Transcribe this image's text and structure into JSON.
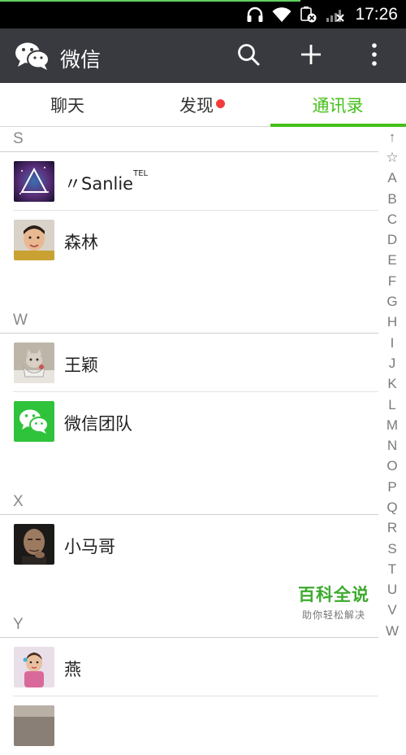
{
  "status_bar": {
    "time": "17:26",
    "icons": [
      "headphones-icon",
      "wifi-icon",
      "battery-saver-icon",
      "signal-icon"
    ]
  },
  "title_bar": {
    "title": "微信",
    "icons": [
      "wechat-logo",
      "search-icon",
      "plus-icon",
      "more-icon"
    ]
  },
  "tabs": [
    {
      "label": "聊天",
      "active": false,
      "badge": false
    },
    {
      "label": "发现",
      "active": false,
      "badge": true
    },
    {
      "label": "通讯录",
      "active": true,
      "badge": false
    }
  ],
  "contacts": {
    "sections": [
      {
        "letter": "S",
        "items": [
          {
            "name": "〃Sanlie",
            "suffix": "TEL"
          },
          {
            "name": "森林"
          }
        ]
      },
      {
        "letter": "W",
        "items": [
          {
            "name": "王颖"
          },
          {
            "name": "微信团队"
          }
        ]
      },
      {
        "letter": "X",
        "items": [
          {
            "name": "小马哥"
          }
        ]
      },
      {
        "letter": "Y",
        "items": [
          {
            "name": "燕"
          }
        ]
      }
    ]
  },
  "index_bar": [
    "↑",
    "☆",
    "A",
    "B",
    "C",
    "D",
    "E",
    "F",
    "G",
    "H",
    "I",
    "J",
    "K",
    "L",
    "M",
    "N",
    "O",
    "P",
    "Q",
    "R",
    "S",
    "T",
    "U",
    "V",
    "W"
  ],
  "watermark": {
    "title": "百科全说",
    "subtitle": "助你轻松解决"
  },
  "colors": {
    "accent": "#45c01a",
    "title_bar": "#393a3f",
    "badge": "#f43b3b"
  }
}
